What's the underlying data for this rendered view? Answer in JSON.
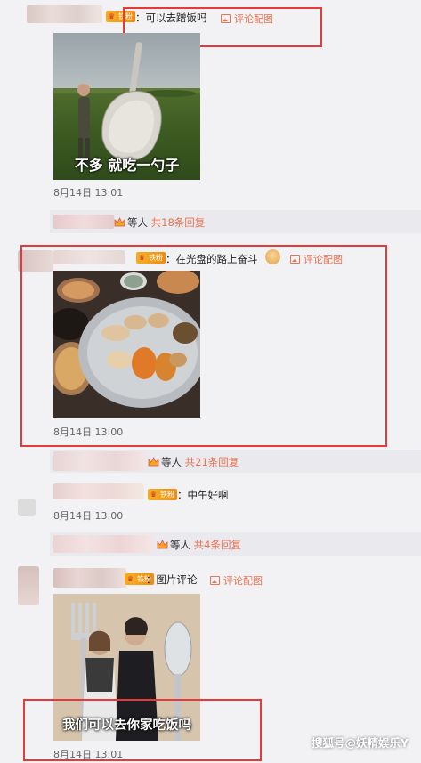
{
  "comments": [
    {
      "badge": "铁粉",
      "text": "：可以去蹭饭吗",
      "pic_link": "评论配图",
      "caption": "不多 就吃一勺子",
      "time": "8月14日 13:01",
      "replies": {
        "who": "等人",
        "count": "共18条回复"
      }
    },
    {
      "badge": "铁粉",
      "text": "：在光盘的路上奋斗",
      "pic_link": "评论配图",
      "time": "8月14日 13:00",
      "replies": {
        "who": "等人",
        "count": "共21条回复"
      }
    },
    {
      "badge": "铁粉",
      "text": "：中午好啊",
      "time": "8月14日 13:00",
      "replies": {
        "who": "等人",
        "count": "共4条回复"
      }
    },
    {
      "badge": "铁粉",
      "text": "：图片评论",
      "pic_link": "评论配图",
      "caption": "我们可以去你家吃饭吗",
      "time": "8月14日 13:01"
    }
  ],
  "watermark": "搜狐号@妖精娱乐Y",
  "colors": {
    "accent": "#eb7350",
    "highlight_box": "#e63a3a",
    "background": "#f2f2f5"
  },
  "icons": {
    "pic_link": "image-icon",
    "fan": "crown-icon",
    "emoji": "dish-emoji-icon"
  }
}
